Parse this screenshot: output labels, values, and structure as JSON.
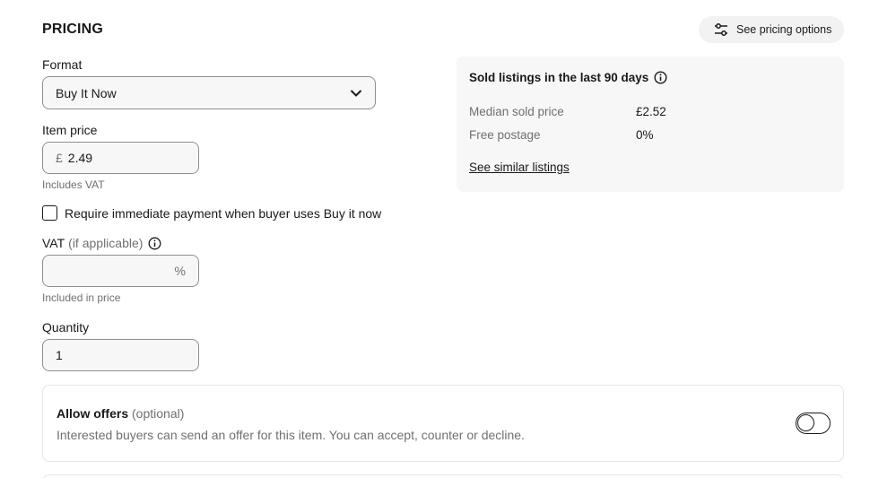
{
  "section": {
    "title": "PRICING"
  },
  "pricing_options": {
    "label": "See pricing options",
    "icon": "sliders-icon"
  },
  "format": {
    "label": "Format",
    "value": "Buy It Now",
    "icon": "chevron-down-icon"
  },
  "item_price": {
    "label": "Item price",
    "currency": "£",
    "value": "2.49",
    "help": "Includes VAT"
  },
  "immediate_payment": {
    "label": "Require immediate payment when buyer uses Buy it now",
    "checked": false
  },
  "vat": {
    "label": "VAT",
    "label_suffix": "(if applicable)",
    "value": "",
    "unit": "%",
    "help": "Included in price",
    "icon": "info-icon"
  },
  "quantity": {
    "label": "Quantity",
    "value": "1"
  },
  "sold": {
    "title": "Sold listings in the last 90 days",
    "icon": "info-icon",
    "stats": [
      {
        "label": "Median sold price",
        "value": "£2.52"
      },
      {
        "label": "Free postage",
        "value": "0%"
      }
    ],
    "link": "See similar listings"
  },
  "offers": {
    "title": "Allow offers",
    "title_suffix": "(optional)",
    "description": "Interested buyers can send an offer for this item. You can accept, counter or decline.",
    "enabled": false
  }
}
